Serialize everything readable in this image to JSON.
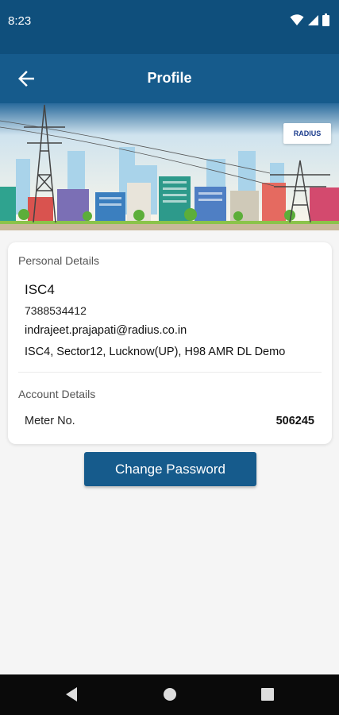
{
  "status_bar": {
    "time": "8:23"
  },
  "app_bar": {
    "title": "Profile"
  },
  "banner": {
    "logo_text": "RADIUS"
  },
  "personal_details": {
    "heading": "Personal Details",
    "name": "ISC4",
    "phone": "7388534412",
    "email": "indrajeet.prajapati@radius.co.in",
    "address": "ISC4, Sector12, Lucknow(UP), H98 AMR DL Demo"
  },
  "account_details": {
    "heading": "Account Details",
    "meter_label": "Meter No.",
    "meter_value": "506245"
  },
  "actions": {
    "change_password_label": "Change Password"
  },
  "colors": {
    "primary": "#165b8c",
    "status_bar": "#0f4f7c"
  }
}
